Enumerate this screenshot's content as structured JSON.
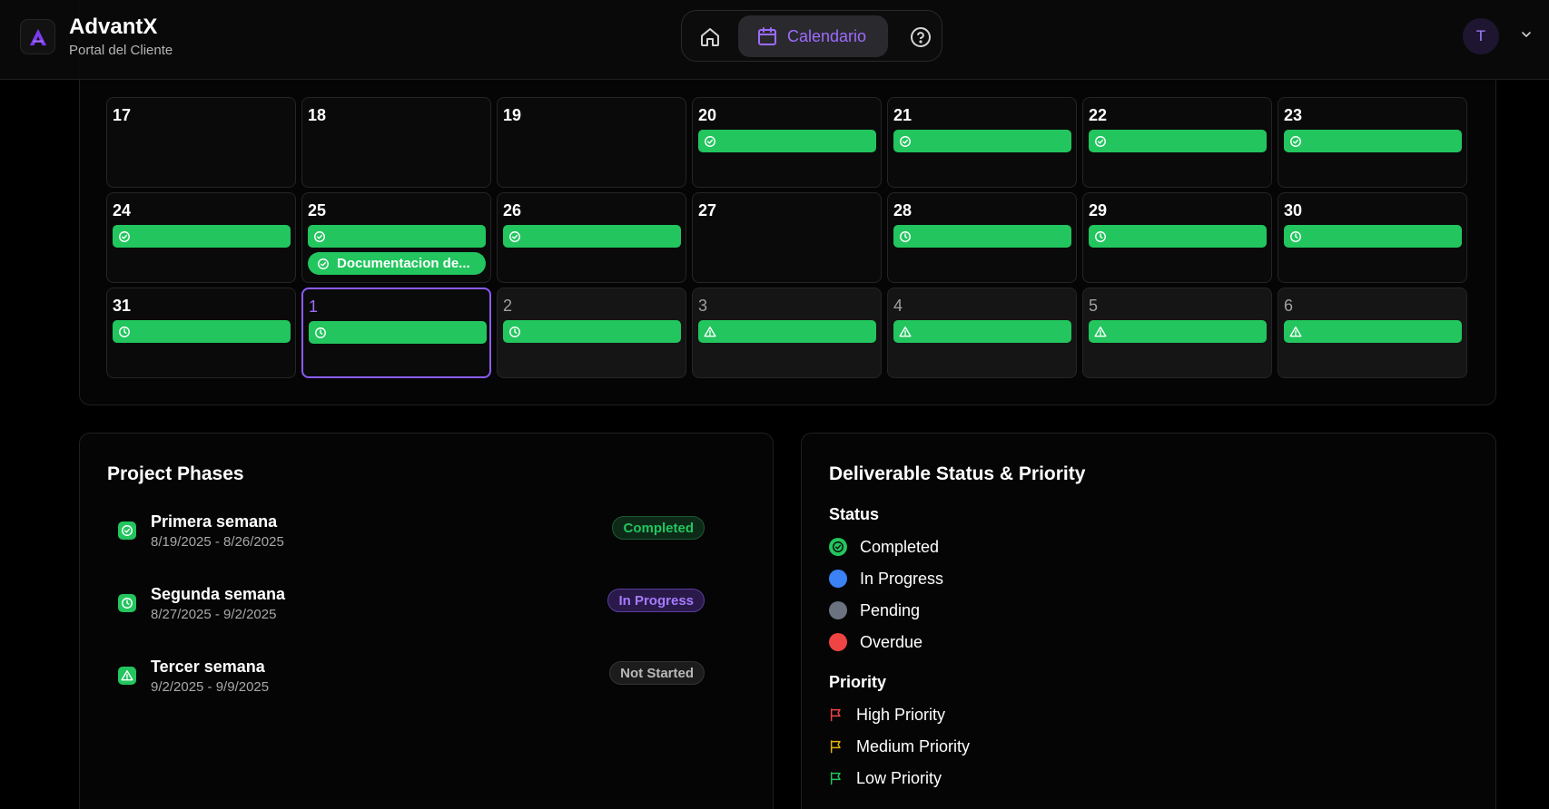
{
  "header": {
    "brand_title": "AdvantX",
    "brand_subtitle": "Portal del Cliente",
    "nav_calendar_label": "Calendario",
    "avatar_initial": "T"
  },
  "calendar": {
    "weeks": [
      [
        {
          "day": "17",
          "events": []
        },
        {
          "day": "18",
          "events": []
        },
        {
          "day": "19",
          "events": []
        },
        {
          "day": "20",
          "events": [
            {
              "icon": "check-circle-icon",
              "label": ""
            }
          ]
        },
        {
          "day": "21",
          "events": [
            {
              "icon": "check-circle-icon",
              "label": ""
            }
          ]
        },
        {
          "day": "22",
          "events": [
            {
              "icon": "check-circle-icon",
              "label": ""
            }
          ]
        },
        {
          "day": "23",
          "events": [
            {
              "icon": "check-circle-icon",
              "label": ""
            }
          ]
        }
      ],
      [
        {
          "day": "24",
          "events": [
            {
              "icon": "check-circle-icon",
              "label": ""
            }
          ]
        },
        {
          "day": "25",
          "events": [
            {
              "icon": "check-circle-icon",
              "label": ""
            },
            {
              "icon": "check-circle-icon",
              "label": "Documentacion de..."
            }
          ]
        },
        {
          "day": "26",
          "events": [
            {
              "icon": "check-circle-icon",
              "label": ""
            }
          ]
        },
        {
          "day": "27",
          "events": []
        },
        {
          "day": "28",
          "events": [
            {
              "icon": "clock-icon",
              "label": ""
            }
          ]
        },
        {
          "day": "29",
          "events": [
            {
              "icon": "clock-icon",
              "label": ""
            }
          ]
        },
        {
          "day": "30",
          "events": [
            {
              "icon": "clock-icon",
              "label": ""
            }
          ]
        }
      ],
      [
        {
          "day": "31",
          "events": [
            {
              "icon": "clock-icon",
              "label": ""
            }
          ]
        },
        {
          "day": "1",
          "today": true,
          "events": [
            {
              "icon": "clock-icon",
              "label": ""
            }
          ]
        },
        {
          "day": "2",
          "other": true,
          "events": [
            {
              "icon": "clock-icon",
              "label": ""
            }
          ]
        },
        {
          "day": "3",
          "other": true,
          "events": [
            {
              "icon": "warning-icon",
              "label": ""
            }
          ]
        },
        {
          "day": "4",
          "other": true,
          "events": [
            {
              "icon": "warning-icon",
              "label": ""
            }
          ]
        },
        {
          "day": "5",
          "other": true,
          "events": [
            {
              "icon": "warning-icon",
              "label": ""
            }
          ]
        },
        {
          "day": "6",
          "other": true,
          "events": [
            {
              "icon": "warning-icon",
              "label": ""
            }
          ]
        }
      ]
    ]
  },
  "phases": {
    "title": "Project Phases",
    "items": [
      {
        "name": "Primera semana",
        "dates": "8/19/2025 - 8/26/2025",
        "status": "Completed",
        "icon": "check-circle-icon"
      },
      {
        "name": "Segunda semana",
        "dates": "8/27/2025 - 9/2/2025",
        "status": "In Progress",
        "icon": "clock-icon"
      },
      {
        "name": "Tercer semana",
        "dates": "9/2/2025 - 9/9/2025",
        "status": "Not Started",
        "icon": "warning-icon"
      }
    ]
  },
  "legend": {
    "title": "Deliverable Status & Priority",
    "status_title": "Status",
    "status_items": [
      {
        "label": "Completed",
        "color": "#22c55e"
      },
      {
        "label": "In Progress",
        "color": "#3b82f6"
      },
      {
        "label": "Pending",
        "color": "#6b7280"
      },
      {
        "label": "Overdue",
        "color": "#ef4444"
      }
    ],
    "priority_title": "Priority",
    "priority_items": [
      {
        "label": "High Priority",
        "color": "#ef4444"
      },
      {
        "label": "Medium Priority",
        "color": "#eab308"
      },
      {
        "label": "Low Priority",
        "color": "#22c55e"
      }
    ]
  },
  "colors": {
    "accent": "#8b5cf6",
    "event_green": "#22c55e"
  }
}
